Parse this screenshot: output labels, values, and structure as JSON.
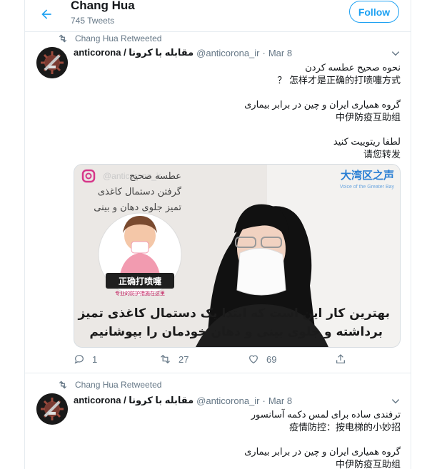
{
  "header": {
    "title": "Chang Hua",
    "subtitle": "745 Tweets",
    "follow_label": "Follow"
  },
  "tweets": [
    {
      "retweet_label": "Chang Hua Retweeted",
      "display_name": "anticorona / مقابله با کرونا",
      "handle": "@anticorona_ir",
      "separator": "·",
      "date": "Mar 8",
      "lines": [
        "نحوه صحیح عطسه کردن",
        "？ 怎样才是正确的打喷嚏方式",
        "",
        "گروه همیاری ایران و چین در برابر بیماری",
        "中伊防疫互助组",
        "",
        "لطفا ریتوییت کنید",
        "请您转发"
      ],
      "media": {
        "watermark": "@anticorona_ir",
        "overlay_lines": [
          "عطسه صحیح",
          "گرفتن دستمال کاغذی",
          "تمیز جلوی دهان و بینی"
        ],
        "badge": "正确打喷嚏",
        "badge_sub": "专业的防护措施在这里",
        "brand": "大湾区之声",
        "brand_sub": "Voice of the Greater Bay",
        "subtitle_lines": [
          "بهترین کار این است که ابتدا یک دستمال کاغذی تمیز",
          "برداشته و جلوی بینی و دهان خودمان را بپوشانیم"
        ]
      },
      "stats": {
        "replies": "1",
        "retweets": "27",
        "likes": "69"
      }
    },
    {
      "retweet_label": "Chang Hua Retweeted",
      "display_name": "anticorona / مقابله با کرونا",
      "handle": "@anticorona_ir",
      "separator": "·",
      "date": "Mar 8",
      "lines": [
        "ترفندی ساده برای لمس دکمه آسانسور",
        "疫情防控：按电梯的小妙招",
        "",
        "گروه همیاری ایران و چین در برابر بیماری",
        "中伊防疫互助组"
      ]
    }
  ],
  "colors": {
    "accent": "#1da1f2",
    "muted": "#657786",
    "border": "#e6ecf0"
  },
  "icons": [
    "back-arrow-icon",
    "retweet-icon",
    "chevron-down-icon",
    "reply-icon",
    "like-icon",
    "share-icon"
  ]
}
